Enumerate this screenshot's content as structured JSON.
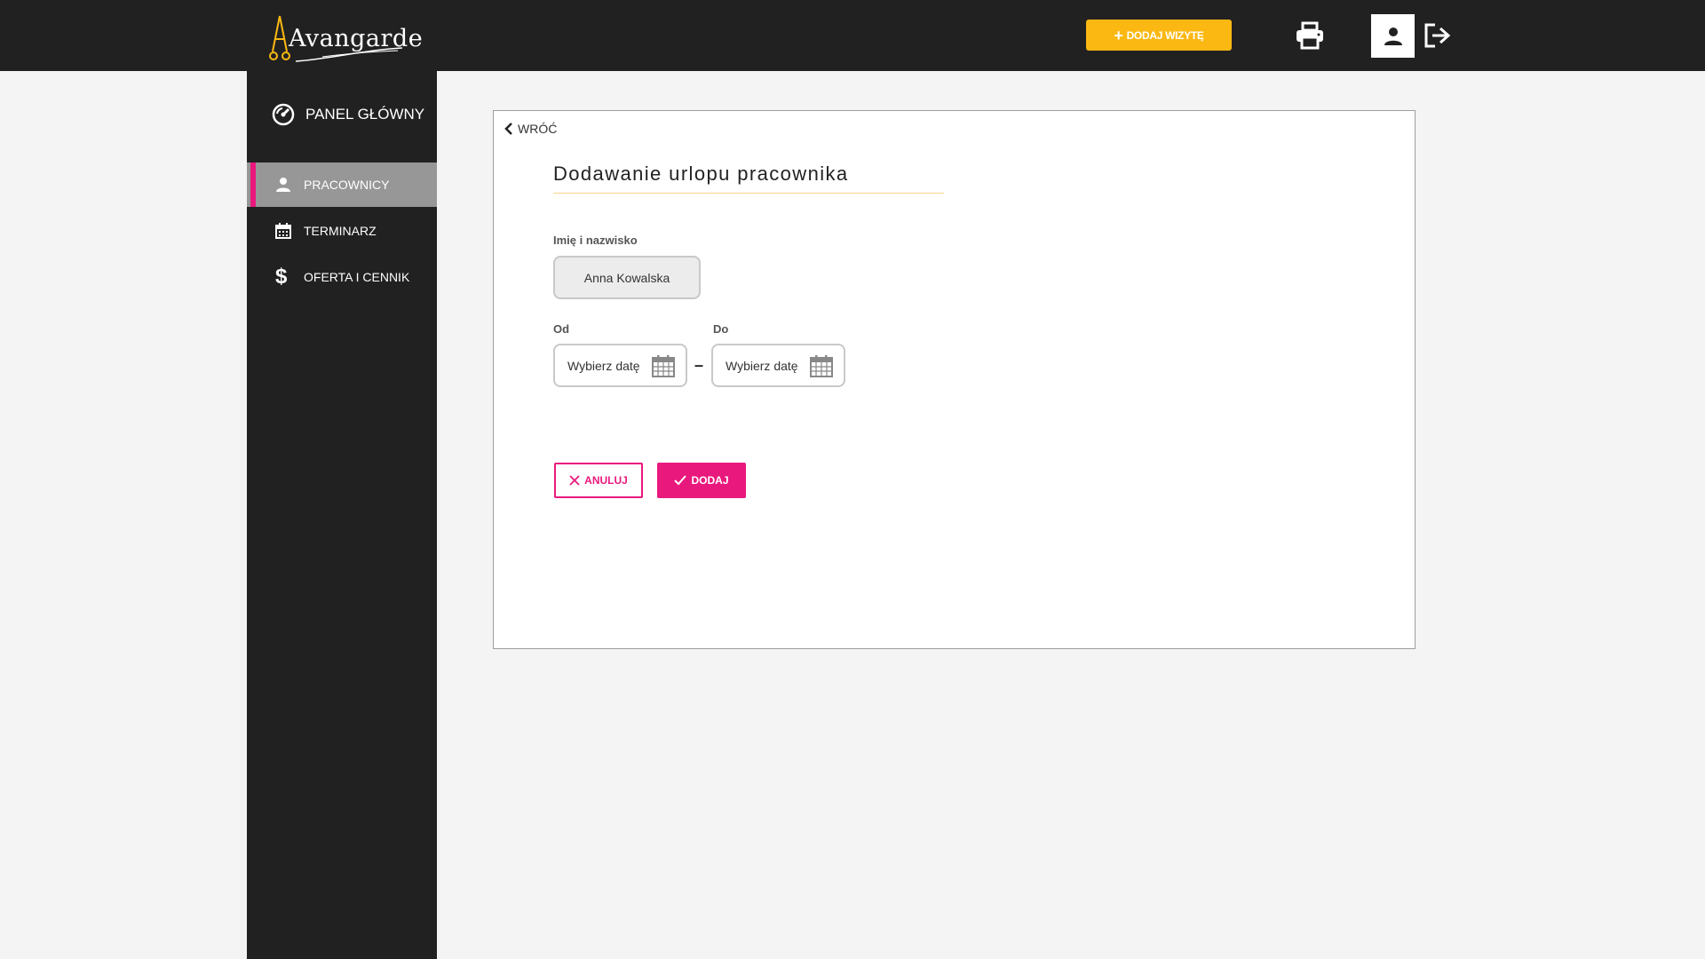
{
  "header": {
    "logo_text": "Avangarde",
    "add_visit_label": "DODAJ WIZYTĘ",
    "colors": {
      "bar": "#212121",
      "accent_yellow": "#fbb812"
    }
  },
  "sidebar": {
    "panel_label": "PANEL GŁÓWNY",
    "items": [
      {
        "label": "PRACOWNICY",
        "icon": "person-icon",
        "active": true
      },
      {
        "label": "TERMINARZ",
        "icon": "calendar-icon",
        "active": false
      },
      {
        "label": "OFERTA I CENNIK",
        "icon": "dollar-icon",
        "active": false
      }
    ],
    "colors": {
      "active_bg": "#979797",
      "active_accent": "#e9187d"
    }
  },
  "form": {
    "back_label": "WRÓĆ",
    "title": "Dodawanie urlopu pracownika",
    "name_label": "Imię i nazwisko",
    "name_value": "Anna Kowalska",
    "from_label": "Od",
    "to_label": "Do",
    "from_placeholder": "Wybierz datę",
    "to_placeholder": "Wybierz datę",
    "separator": "–",
    "cancel_label": "ANULUJ",
    "add_label": "DODAJ",
    "colors": {
      "primary": "#e9187d"
    }
  }
}
